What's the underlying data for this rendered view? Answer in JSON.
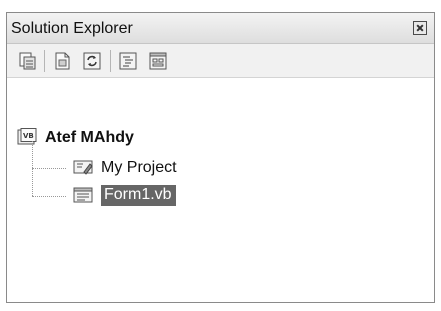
{
  "panel": {
    "title": "Solution Explorer"
  },
  "toolbar": {
    "buttons": [
      "properties-icon",
      "show-all-files-icon",
      "refresh-icon",
      "view-code-icon",
      "view-designer-icon"
    ]
  },
  "tree": {
    "root": {
      "label": "Atef MAhdy",
      "icon": "vb-project-icon"
    },
    "children": [
      {
        "label": "My Project",
        "icon": "my-project-icon",
        "selected": false
      },
      {
        "label": "Form1.vb",
        "icon": "form-icon",
        "selected": true
      }
    ]
  },
  "colors": {
    "selection": "#666666",
    "border": "#8a8a8a"
  }
}
